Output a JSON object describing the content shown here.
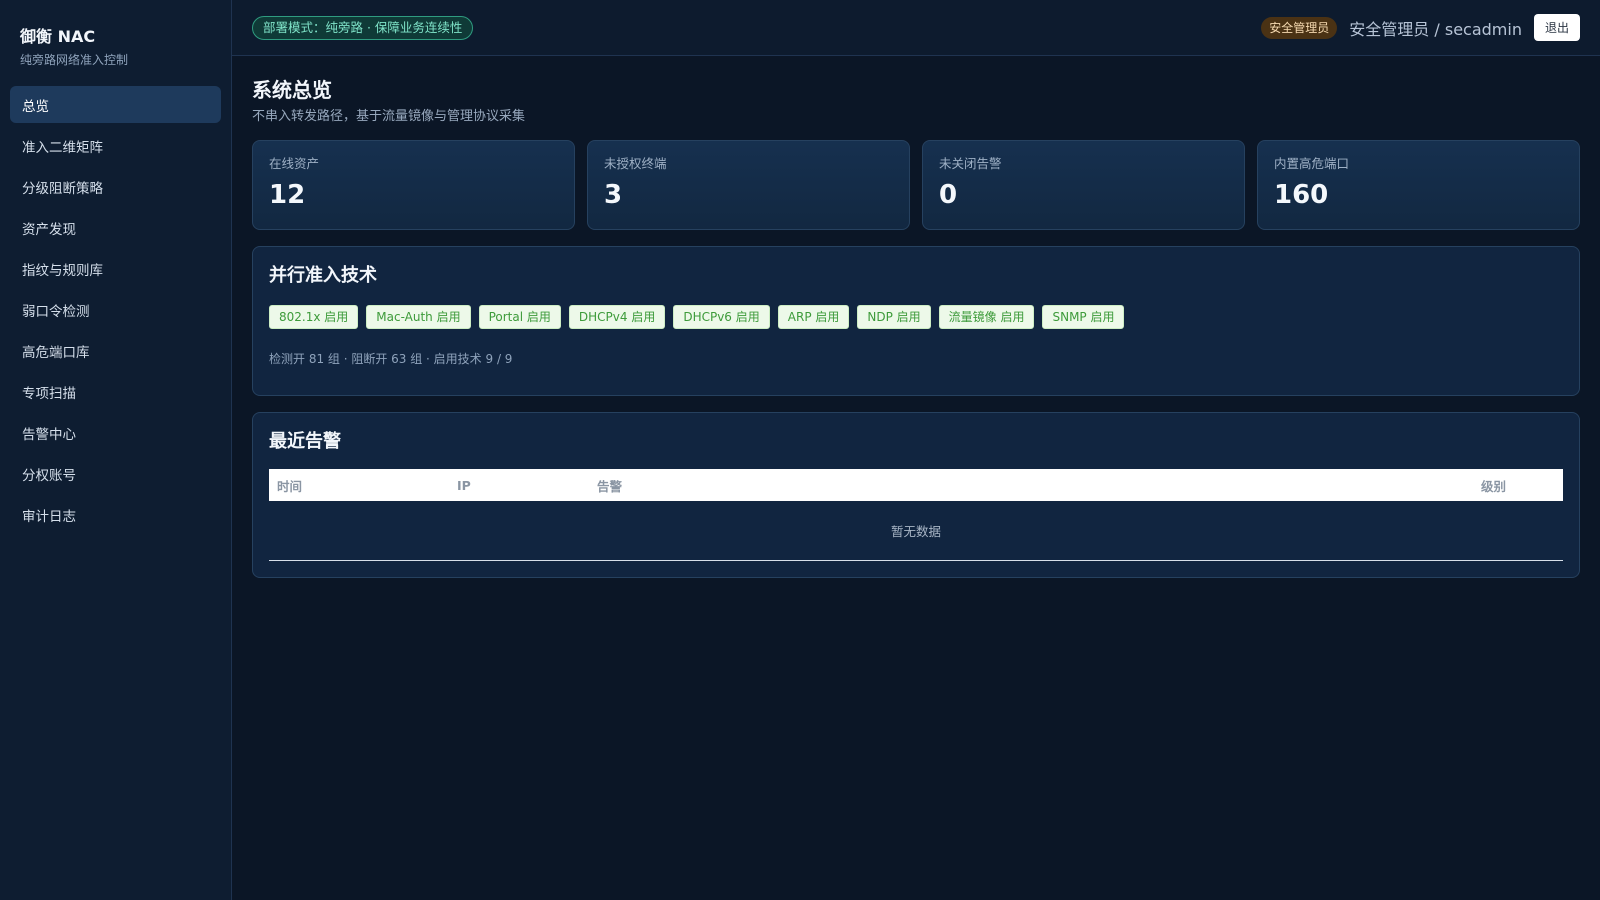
{
  "brand": {
    "name": "御衡 NAC",
    "subtitle": "纯旁路网络准入控制"
  },
  "nav": [
    {
      "label": "总览",
      "active": true
    },
    {
      "label": "准入二维矩阵"
    },
    {
      "label": "分级阻断策略"
    },
    {
      "label": "资产发现"
    },
    {
      "label": "指纹与规则库"
    },
    {
      "label": "弱口令检测"
    },
    {
      "label": "高危端口库"
    },
    {
      "label": "专项扫描"
    },
    {
      "label": "告警中心"
    },
    {
      "label": "分权账号"
    },
    {
      "label": "审计日志"
    }
  ],
  "topbar": {
    "mode_badge": "部署模式：纯旁路 · 保障业务连续性",
    "role_badge": "安全管理员",
    "user": "安全管理员 / secadmin",
    "logout": "退出"
  },
  "page": {
    "title": "系统总览",
    "subtitle": "不串入转发路径，基于流量镜像与管理协议采集"
  },
  "stats": [
    {
      "label": "在线资产",
      "value": "12"
    },
    {
      "label": "未授权终端",
      "value": "3"
    },
    {
      "label": "未关闭告警",
      "value": "0"
    },
    {
      "label": "内置高危端口",
      "value": "160"
    }
  ],
  "tech_panel": {
    "title": "并行准入技术",
    "tags": [
      "802.1x 启用",
      "Mac-Auth 启用",
      "Portal 启用",
      "DHCPv4 启用",
      "DHCPv6 启用",
      "ARP 启用",
      "NDP 启用",
      "流量镜像 启用",
      "SNMP 启用"
    ],
    "summary": "检测开 81 组 · 阻断开 63 组 · 启用技术 9 / 9"
  },
  "alerts_panel": {
    "title": "最近告警",
    "columns": [
      "时间",
      "IP",
      "告警",
      "级别"
    ],
    "empty_text": "暂无数据"
  },
  "colors": {
    "background": "#0b1626",
    "sidebar": "#0e1d31",
    "accent_active": "#1e3a5c",
    "success_tag_text": "#3d9b3a",
    "mode_badge": "#7fe3c8",
    "role_badge_bg": "#4a3214"
  }
}
